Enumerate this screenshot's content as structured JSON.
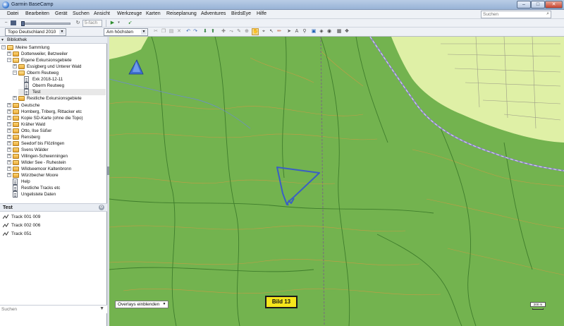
{
  "window": {
    "title": "Garmin BaseCamp",
    "min_label": "–",
    "max_label": "□",
    "close_label": "✕"
  },
  "menu": {
    "items": [
      "Datei",
      "Bearbeiten",
      "Gerät",
      "Suchen",
      "Ansicht",
      "Werkzeuge",
      "Karten",
      "Reiseplanung",
      "Adventures",
      "BirdsEye",
      "Hilfe"
    ],
    "search_placeholder": "Suchen"
  },
  "toolbar": {
    "zoom_multiplier": "5-fach"
  },
  "droprow": {
    "map_product": "Topo Deutschland 2010",
    "map_detail": "Am höchsten"
  },
  "library": {
    "header": "Bibliothek",
    "nodes": [
      {
        "label": "Meine Sammlung",
        "type": "root",
        "expand": "−"
      },
      {
        "label": "Dottenweiler, Betzweiler",
        "type": "folder",
        "expand": "+"
      },
      {
        "label": "Eigene Exkursionsgebiete",
        "type": "folder-open",
        "expand": "−"
      },
      {
        "label": "Essigberg und Unterer Wald",
        "type": "folder",
        "expand": "+"
      },
      {
        "label": "Oberm Reutweg",
        "type": "folder-open",
        "expand": "−"
      },
      {
        "label": "Exk 2018-12-11",
        "type": "list"
      },
      {
        "label": "Oberm Reutweg",
        "type": "list"
      },
      {
        "label": "Test",
        "type": "list",
        "selected": true
      },
      {
        "label": "Restliche Exkursionsgebiete",
        "type": "folder",
        "expand": "+"
      },
      {
        "label": "Geutsche",
        "type": "folder",
        "expand": "+"
      },
      {
        "label": "Homberg, Triberg, Rittacker etc",
        "type": "folder",
        "expand": "+"
      },
      {
        "label": "Kopie SD-Karte (ohne die Topo)",
        "type": "folder",
        "expand": "+"
      },
      {
        "label": "Kräher Wald",
        "type": "folder",
        "expand": "+"
      },
      {
        "label": "Otto, Ilse Süßer",
        "type": "folder",
        "expand": "+"
      },
      {
        "label": "Rensberg",
        "type": "folder",
        "expand": "+"
      },
      {
        "label": "Seedorf bis Flözlingen",
        "type": "folder",
        "expand": "+"
      },
      {
        "label": "Svens Wälder",
        "type": "folder",
        "expand": "+"
      },
      {
        "label": "Villingen-Schwenningen",
        "type": "folder",
        "expand": "+"
      },
      {
        "label": "Wilder See - Ruhestein",
        "type": "folder",
        "expand": "+"
      },
      {
        "label": "Wildseemoor Kaltenbronn",
        "type": "folder",
        "expand": "+"
      },
      {
        "label": "Würzbecher Moore",
        "type": "folder",
        "expand": "+"
      },
      {
        "label": "Help",
        "type": "list"
      },
      {
        "label": "Restliche Tracks etc",
        "type": "list"
      },
      {
        "label": "Ungelistete Daten",
        "type": "list"
      }
    ]
  },
  "test_panel": {
    "title": "Test",
    "tracks": [
      "Track 001 009",
      "Track 002 006",
      "Track 051"
    ]
  },
  "left_search_placeholder": "Suchen",
  "map": {
    "overlay_label": "Overlays einblenden",
    "badge": "Bild 13",
    "scale_label": "200 m",
    "colors": {
      "forest": "#73b34f",
      "open_land": "#dff0a6",
      "track": "#3a5fc4",
      "river": "#8f86c8"
    }
  }
}
